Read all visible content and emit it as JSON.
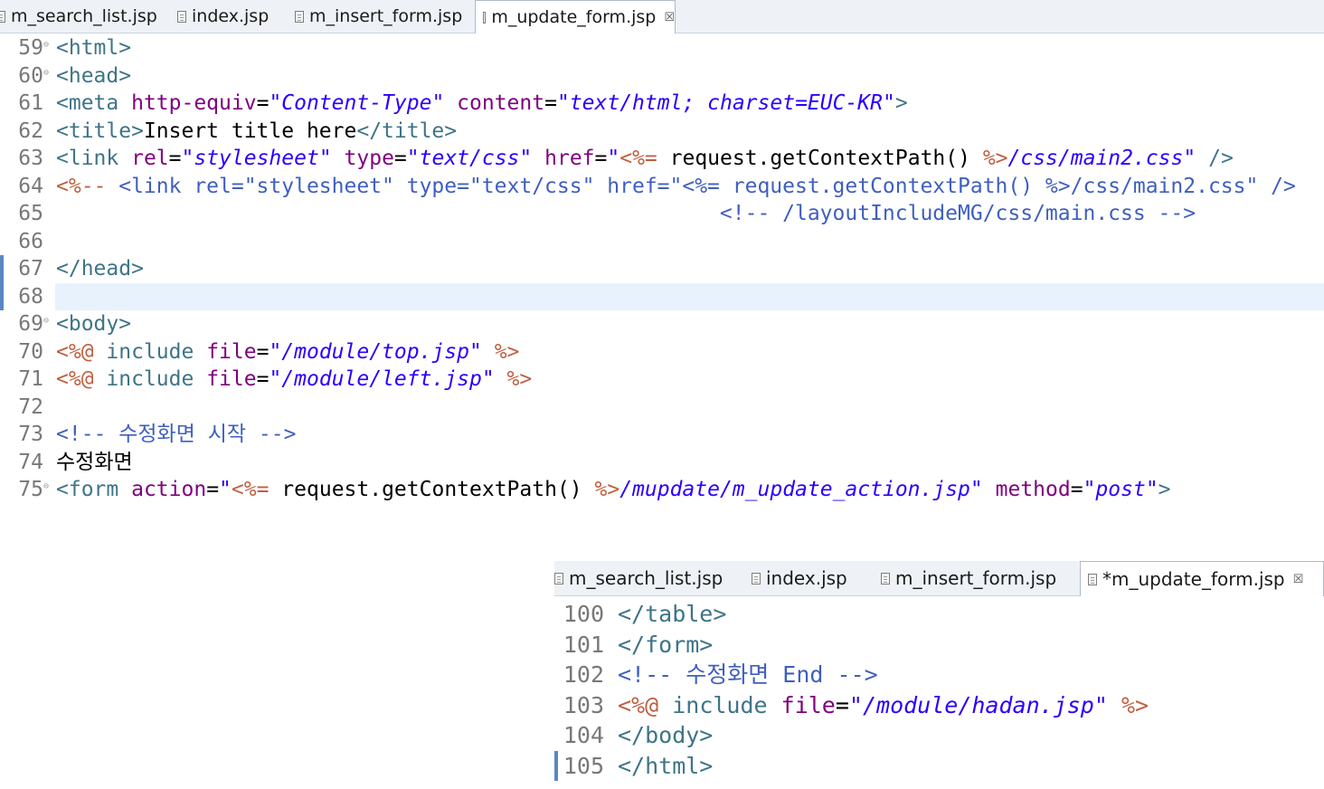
{
  "editor_top": {
    "tabs": [
      {
        "label": "m_search_list.jsp"
      },
      {
        "label": "index.jsp"
      },
      {
        "label": "m_insert_form.jsp"
      },
      {
        "label": "m_update_form.jsp",
        "active": true,
        "close_glyph": "☒"
      }
    ],
    "lines": [
      {
        "num": "59",
        "fold": "⊖",
        "tokens": [
          {
            "c": "t",
            "s": "<html>"
          }
        ]
      },
      {
        "num": "60",
        "fold": "⊖",
        "tokens": [
          {
            "c": "t",
            "s": "<head>"
          }
        ]
      },
      {
        "num": "61",
        "tokens": [
          {
            "c": "t",
            "s": "<meta "
          },
          {
            "c": "a",
            "s": "http-equiv"
          },
          {
            "c": "tx",
            "s": "="
          },
          {
            "c": "v",
            "s": "\"Content-Type\""
          },
          {
            "c": "tx",
            "s": " "
          },
          {
            "c": "a",
            "s": "content"
          },
          {
            "c": "tx",
            "s": "="
          },
          {
            "c": "v",
            "s": "\"text/html; charset=EUC-KR\""
          },
          {
            "c": "t",
            "s": ">"
          }
        ]
      },
      {
        "num": "62",
        "tokens": [
          {
            "c": "t",
            "s": "<title>"
          },
          {
            "c": "tx",
            "s": "Insert title here"
          },
          {
            "c": "t",
            "s": "</title>"
          }
        ]
      },
      {
        "num": "63",
        "tokens": [
          {
            "c": "t",
            "s": "<link "
          },
          {
            "c": "a",
            "s": "rel"
          },
          {
            "c": "tx",
            "s": "="
          },
          {
            "c": "v",
            "s": "\"stylesheet\""
          },
          {
            "c": "tx",
            "s": " "
          },
          {
            "c": "a",
            "s": "type"
          },
          {
            "c": "tx",
            "s": "="
          },
          {
            "c": "v",
            "s": "\"text/css\""
          },
          {
            "c": "tx",
            "s": " "
          },
          {
            "c": "a",
            "s": "href"
          },
          {
            "c": "tx",
            "s": "="
          },
          {
            "c": "v",
            "s": "\""
          },
          {
            "c": "j",
            "s": "<%="
          },
          {
            "c": "tx",
            "s": " request.getContextPath() "
          },
          {
            "c": "j",
            "s": "%>"
          },
          {
            "c": "v",
            "s": "/css/main2.css\""
          },
          {
            "c": "tx",
            "s": " "
          },
          {
            "c": "t",
            "s": "/>"
          }
        ]
      },
      {
        "num": "64",
        "tokens": [
          {
            "c": "j",
            "s": "<%--"
          },
          {
            "c": "cm",
            "s": " <link rel=\"stylesheet\" type=\"text/css\" href=\"<%= request.getContextPath() %>/css/main2.css\" />"
          }
        ]
      },
      {
        "num": "65",
        "tokens": [
          {
            "c": "cm",
            "s": "                                                     <!-- /layoutIncludeMG/css/main.css -->"
          }
        ]
      },
      {
        "num": "66",
        "tokens": []
      },
      {
        "num": "67",
        "marker": true,
        "tokens": [
          {
            "c": "t",
            "s": "</head>"
          }
        ]
      },
      {
        "num": "68",
        "marker": true,
        "highlight": true,
        "tokens": []
      },
      {
        "num": "69",
        "fold": "⊖",
        "tokens": [
          {
            "c": "t",
            "s": "<body>"
          }
        ]
      },
      {
        "num": "70",
        "tokens": [
          {
            "c": "j",
            "s": "<%@"
          },
          {
            "c": "tx",
            "s": " "
          },
          {
            "c": "t",
            "s": "include "
          },
          {
            "c": "a",
            "s": "file"
          },
          {
            "c": "tx",
            "s": "="
          },
          {
            "c": "v",
            "s": "\"/module/top.jsp\""
          },
          {
            "c": "tx",
            "s": " "
          },
          {
            "c": "j",
            "s": "%>"
          }
        ]
      },
      {
        "num": "71",
        "tokens": [
          {
            "c": "j",
            "s": "<%@"
          },
          {
            "c": "tx",
            "s": " "
          },
          {
            "c": "t",
            "s": "include "
          },
          {
            "c": "a",
            "s": "file"
          },
          {
            "c": "tx",
            "s": "="
          },
          {
            "c": "v",
            "s": "\"/module/left.jsp\""
          },
          {
            "c": "tx",
            "s": " "
          },
          {
            "c": "j",
            "s": "%>"
          }
        ]
      },
      {
        "num": "72",
        "tokens": []
      },
      {
        "num": "73",
        "tokens": [
          {
            "c": "cm",
            "s": "<!-- 수정화면 시작 -->"
          }
        ]
      },
      {
        "num": "74",
        "tokens": [
          {
            "c": "tx",
            "s": "수정화면"
          }
        ]
      },
      {
        "num": "75",
        "fold": "⊖",
        "tokens": [
          {
            "c": "t",
            "s": "<form "
          },
          {
            "c": "a",
            "s": "action"
          },
          {
            "c": "tx",
            "s": "="
          },
          {
            "c": "v",
            "s": "\""
          },
          {
            "c": "j",
            "s": "<%="
          },
          {
            "c": "tx",
            "s": " request.getContextPath() "
          },
          {
            "c": "j",
            "s": "%>"
          },
          {
            "c": "v",
            "s": "/mupdate/m_update_action.jsp\""
          },
          {
            "c": "tx",
            "s": " "
          },
          {
            "c": "a",
            "s": "method"
          },
          {
            "c": "tx",
            "s": "="
          },
          {
            "c": "v",
            "s": "\"post\""
          },
          {
            "c": "t",
            "s": ">"
          }
        ]
      }
    ]
  },
  "editor_bottom": {
    "tabs": [
      {
        "label": "m_search_list.jsp"
      },
      {
        "label": "index.jsp"
      },
      {
        "label": "m_insert_form.jsp"
      },
      {
        "label": "*m_update_form.jsp",
        "active": true,
        "close_glyph": "☒"
      }
    ],
    "lines": [
      {
        "num": "100",
        "tokens": [
          {
            "c": "t",
            "s": "</table>"
          }
        ]
      },
      {
        "num": "101",
        "tokens": [
          {
            "c": "t",
            "s": "</form>"
          }
        ]
      },
      {
        "num": "102",
        "tokens": [
          {
            "c": "cm",
            "s": "<!-- 수정화면 End -->"
          }
        ]
      },
      {
        "num": "103",
        "tokens": [
          {
            "c": "j",
            "s": "<%@"
          },
          {
            "c": "tx",
            "s": " "
          },
          {
            "c": "t",
            "s": "include "
          },
          {
            "c": "a",
            "s": "file"
          },
          {
            "c": "tx",
            "s": "="
          },
          {
            "c": "v",
            "s": "\"/module/hadan.jsp\""
          },
          {
            "c": "tx",
            "s": " "
          },
          {
            "c": "j",
            "s": "%>"
          }
        ]
      },
      {
        "num": "104",
        "tokens": [
          {
            "c": "t",
            "s": "</body>"
          }
        ]
      },
      {
        "num": "105",
        "marker": true,
        "tokens": [
          {
            "c": "t",
            "s": "</html>"
          }
        ]
      }
    ]
  },
  "colors": {
    "tag": "#3e7487",
    "attribute": "#7f007f",
    "value": "#2a00ff",
    "jsp_delimiter": "#bf5f3f",
    "comment": "#3f5fbf",
    "text": "#000000",
    "line_number": "#787878",
    "current_line": "#e8f2fd",
    "change_marker": "#5b87c5"
  }
}
